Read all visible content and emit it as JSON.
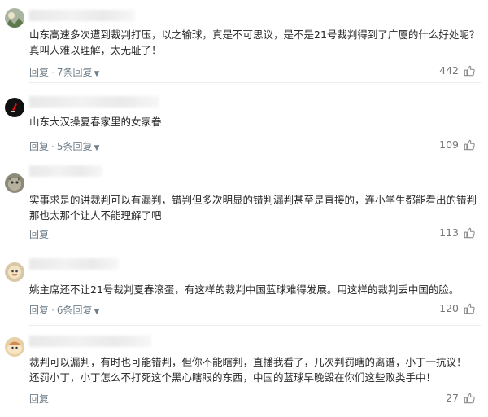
{
  "comments": [
    {
      "text_lines": [
        "山东高速多次遭到裁判打压，以之输球，真是不可思议，是不是21号裁判得到了广厦的什么好处呢？",
        "真叫人难以理解，太无耻了！"
      ],
      "reply_label": "回复",
      "replies_label": "7条回复",
      "likes": "442"
    },
    {
      "text_lines": [
        "山东大汉操夏春家里的女家眷"
      ],
      "reply_label": "回复",
      "replies_label": "5条回复",
      "likes": "109"
    },
    {
      "text_lines": [
        "实事求是的讲裁判可以有漏判，错判但多次明显的错判漏判甚至是直接的，连小学生都能看出的错判",
        "那也太那个让人不能理解了吧"
      ],
      "reply_label": "回复",
      "likes": "113"
    },
    {
      "text_lines": [
        "姚主席还不让21号裁判夏春滚蛋，有这样的裁判中国蓝球难得发展。用这样的裁判丢中国的脸。"
      ],
      "reply_label": "回复",
      "replies_label": "6条回复",
      "likes": "120"
    },
    {
      "text_lines": [
        "裁判可以漏判，有时也可能错判，但你不能瞎判，直播我看了，几次判罚瞎的离谱，小丁一抗议！",
        "还罚小丁，小丁怎么不打死这个黑心瞎眼的东西，中国的蓝球早晚毁在你们这些败类手中！"
      ],
      "reply_label": "回复",
      "likes": "27"
    }
  ],
  "icons": {
    "thumb_up": "thumb-up-icon",
    "chevron": "chevron-down-icon"
  },
  "colors": {
    "meta": "#6f7d89",
    "text": "#2a2a2a",
    "divider": "#ececec"
  }
}
